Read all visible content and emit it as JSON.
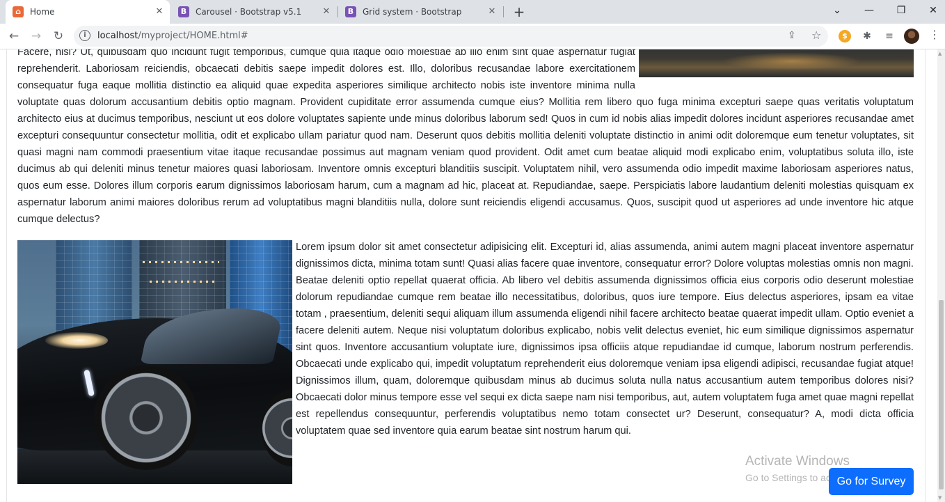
{
  "browser": {
    "tabs": [
      {
        "title": "Home",
        "favicon": "home-favicon",
        "favicon_text": "🏠",
        "active": true
      },
      {
        "title": "Carousel · Bootstrap v5.1",
        "favicon": "bootstrap-favicon",
        "favicon_text": "B",
        "active": false
      },
      {
        "title": "Grid system · Bootstrap",
        "favicon": "bootstrap-favicon",
        "favicon_text": "B",
        "active": false
      }
    ],
    "new_tab_glyph": "+",
    "tab_close_glyph": "✕",
    "url_host": "localhost",
    "url_path": "/myproject/HOME.html#",
    "window_controls": {
      "tab_search": "⌄",
      "minimize": "—",
      "restore": "❐",
      "close": "✕"
    },
    "nav": {
      "back": "←",
      "forward": "→",
      "reload": "↻"
    },
    "omnibox_icons": {
      "share": "⇪",
      "bookmark": "☆"
    },
    "extensions": {
      "orange": "$",
      "puzzle": "✱",
      "media": "≡"
    },
    "menu_glyph": "⋮"
  },
  "page": {
    "top_paragraph": "Facere, nisi? Ut, quibusdam quo incidunt fugit temporibus, cumque quia itaque odio molestiae ab illo enim sint quae aspernatur fugiat reprehenderit. Laboriosam reiciendis, obcaecati debitis saepe impedit dolores est. Illo, doloribus recusandae labore exercitationem consequatur fuga eaque mollitia distinctio ea aliquid quae expedita asperiores similique architecto nobis iste inventore minima nulla voluptate quas dolorum accusantium debitis optio magnam. Provident cupiditate error assumenda cumque eius? Mollitia rem libero quo fuga minima excepturi saepe quas veritatis voluptatum architecto eius at ducimus temporibus, nesciunt ut eos dolore voluptates sapiente unde minus doloribus laborum sed! Quos in cum id nobis alias impedit dolores incidunt asperiores recusandae amet excepturi consequuntur consectetur mollitia, odit et explicabo ullam pariatur quod nam. Deserunt quos debitis mollitia deleniti voluptate distinctio in animi odit doloremque eum tenetur voluptates, sit quasi magni nam commodi praesentium vitae itaque recusandae possimus aut magnam veniam quod provident. Odit amet cum beatae aliquid modi explicabo enim, voluptatibus soluta illo, iste ducimus ab qui deleniti minus tenetur maiores quasi laboriosam. Inventore omnis excepturi blanditiis suscipit. Voluptatem nihil, vero assumenda odio impedit maxime laboriosam asperiores natus, quos eum esse. Dolores illum corporis earum dignissimos laboriosam harum, cum a magnam ad hic, placeat at. Repudiandae, saepe. Perspiciatis labore laudantium deleniti molestias quisquam ex aspernatur laborum animi maiores doloribus rerum ad voluptatibus magni blanditiis nulla, dolore sunt reiciendis eligendi accusamus. Quos, suscipit quod ut asperiores ad unde inventore hic atque cumque delectus?",
    "second_paragraph": "Lorem ipsum dolor sit amet consectetur adipisicing elit. Excepturi id, alias assumenda, animi autem magni placeat inventore aspernatur dignissimos dicta, minima totam sunt! Quasi alias facere quae inventore, consequatur error? Dolore voluptas molestias omnis non magni. Beatae deleniti optio repellat quaerat officia. Ab libero vel debitis assumenda dignissimos officia eius corporis odio deserunt molestiae dolorum repudiandae cumque rem beatae illo necessitatibus, doloribus, quos iure tempore. Eius delectus asperiores, ipsam ea vitae totam , praesentium, deleniti sequi aliquam illum assumenda eligendi nihil facere architecto beatae quaerat impedit ullam. Optio eveniet a facere deleniti autem. Neque nisi voluptatum doloribus explicabo, nobis velit delectus eveniet, hic eum similique dignissimos aspernatur sint quos. Inventore accusantium voluptate iure, dignissimos ipsa officiis atque repudiandae id cumque, laborum nostrum perferendis. Obcaecati unde explicabo qui, impedit voluptatum reprehenderit eius doloremque veniam ipsa eligendi adipisci, recusandae fugiat atque! Dignissimos illum, quam, doloremque quibusdam minus ab ducimus soluta nulla natus accusantium autem temporibus dolores nisi? Obcaecati dolor minus tempore esse vel sequi ex dicta saepe nam nisi temporibus, aut, autem voluptatem fuga amet quae magni repellat est repellendus consequuntur, perferendis voluptatibus nemo totam consectet ur? Deserunt, consequatur? A, modi dicta officia voluptatem quae sed inventore quia earum beatae sint nostrum harum qui.",
    "survey_button": "Go for Survey",
    "button_color": "#0d6efd"
  },
  "os_watermark": {
    "line1": "Activate Windows",
    "line2": "Go to Settings to activate Windows."
  },
  "scrollbar": {
    "up": "▲",
    "down": "▼"
  }
}
